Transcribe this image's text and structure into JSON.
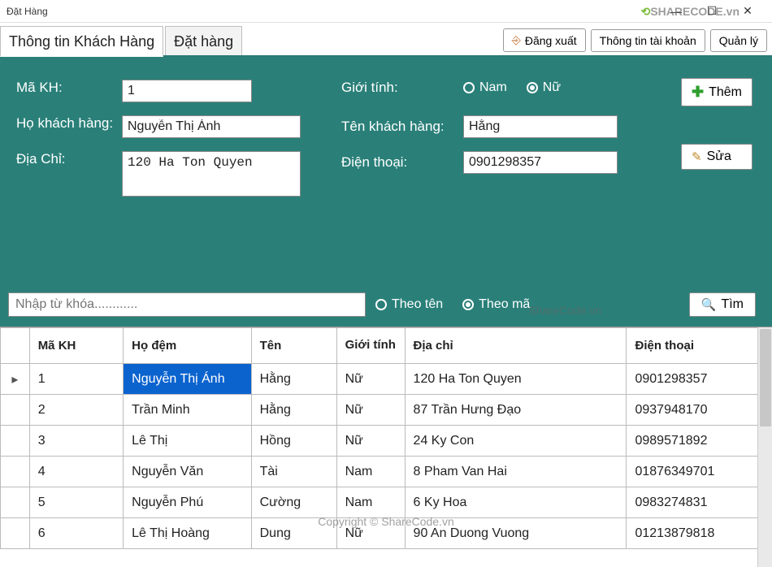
{
  "window": {
    "title": "Đặt Hàng"
  },
  "toolbar": {
    "logout": "Đăng xuất",
    "account": "Thông tin tài khoản",
    "manage": "Quản lý"
  },
  "tabs": {
    "customer_info": "Thông tin Khách Hàng",
    "order": "Đặt hàng"
  },
  "form": {
    "ma_kh_label": "Mã KH:",
    "ma_kh_value": "1",
    "ho_label": "Họ khách hàng:",
    "ho_value": "Nguyễn Thị Ánh",
    "diachi_label": "Địa Chỉ:",
    "diachi_value": "120 Ha Ton Quyen",
    "gioitinh_label": "Giới tính:",
    "gioitinh_nam": "Nam",
    "gioitinh_nu": "Nữ",
    "gioitinh_selected": "Nữ",
    "ten_label": "Tên khách hàng:",
    "ten_value": "Hằng",
    "dienthoai_label": "Điện thoại:",
    "dienthoai_value": "0901298357",
    "btn_them": "Thêm",
    "btn_sua": "Sửa"
  },
  "search": {
    "placeholder": "Nhập từ khóa............",
    "theo_ten": "Theo tên",
    "theo_ma": "Theo mã",
    "selected": "Theo mã",
    "btn_tim": "Tìm"
  },
  "table": {
    "headers": {
      "ma_kh": "Mã KH",
      "ho_dem": "Họ đệm",
      "ten": "Tên",
      "gioi_tinh": "Giới tính",
      "dia_chi": "Địa chỉ",
      "dien_thoai": "Điện thoại"
    },
    "rows": [
      {
        "ma": "1",
        "ho": "Nguyễn Thị Ánh",
        "ten": "Hằng",
        "gt": "Nữ",
        "dc": "120 Ha Ton Quyen",
        "dt": "0901298357"
      },
      {
        "ma": "2",
        "ho": "Trần Minh",
        "ten": "Hằng",
        "gt": "Nữ",
        "dc": "87 Trần Hưng Đạo",
        "dt": "0937948170"
      },
      {
        "ma": "3",
        "ho": "Lê Thị",
        "ten": "Hồng",
        "gt": "Nữ",
        "dc": "24 Ky Con",
        "dt": "0989571892"
      },
      {
        "ma": "4",
        "ho": "Nguyễn Văn",
        "ten": " Tài",
        "gt": "Nam",
        "dc": "8 Pham Van Hai",
        "dt": "01876349701"
      },
      {
        "ma": "5",
        "ho": "Nguyễn Phú",
        "ten": "Cường",
        "gt": "Nam",
        "dc": "6 Ky Hoa",
        "dt": "0983274831"
      },
      {
        "ma": "6",
        "ho": "Lê Thị Hoàng",
        "ten": "Dung",
        "gt": "Nữ",
        "dc": "90 An Duong Vuong",
        "dt": "01213879818"
      }
    ],
    "selected_row": 0,
    "selected_col": "ho"
  },
  "watermarks": {
    "brand": "SHARECODE.vn",
    "site": "ShareCode.vn",
    "copyright": "Copyright © ShareCode.vn"
  }
}
